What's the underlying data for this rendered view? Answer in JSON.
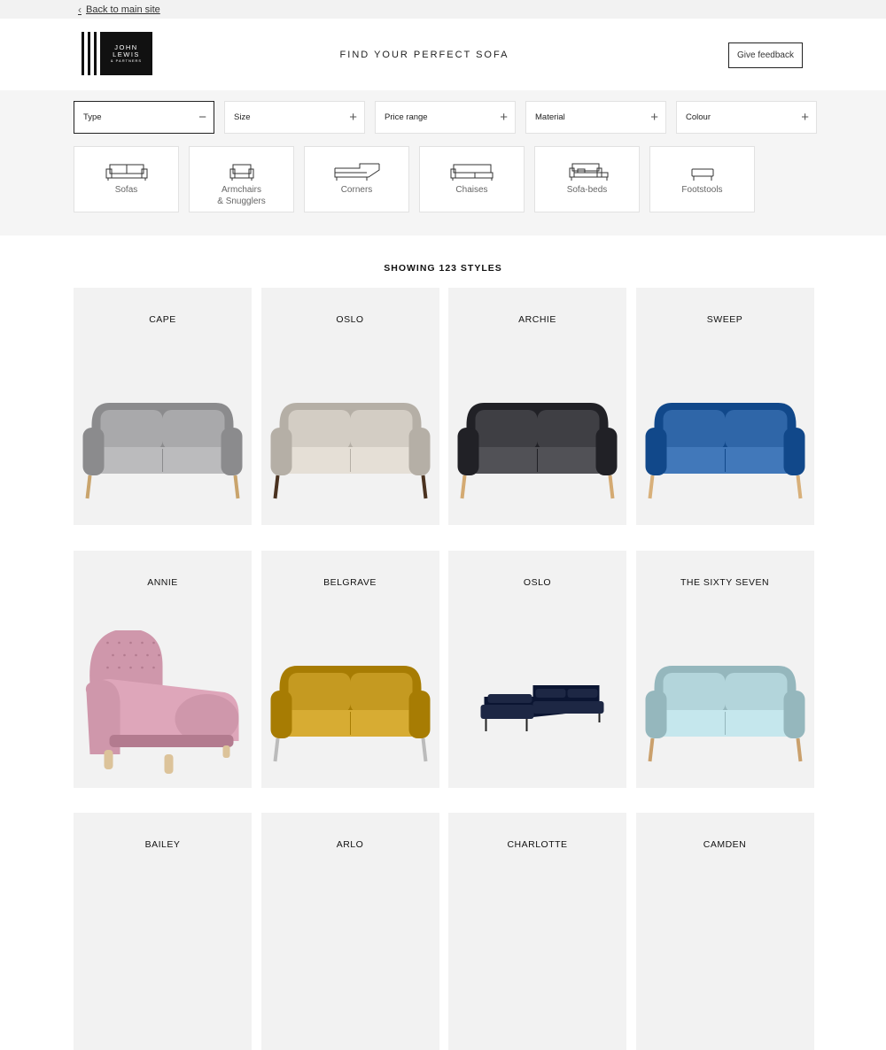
{
  "topbar": {
    "back_label": "Back to main site"
  },
  "header": {
    "logo": {
      "line1": "JOHN",
      "line2": "LEWIS",
      "line3": "& PARTNERS"
    },
    "title": "FIND YOUR PERFECT SOFA",
    "feedback_label": "Give feedback"
  },
  "filters": [
    {
      "label": "Type",
      "state": "open",
      "symbol": "−"
    },
    {
      "label": "Size",
      "state": "closed",
      "symbol": "+"
    },
    {
      "label": "Price range",
      "state": "closed",
      "symbol": "+"
    },
    {
      "label": "Material",
      "state": "closed",
      "symbol": "+"
    },
    {
      "label": "Colour",
      "state": "closed",
      "symbol": "+"
    }
  ],
  "types": [
    {
      "label": "Sofas",
      "icon": "sofa-icon"
    },
    {
      "label": "Armchairs\n& Snugglers",
      "icon": "armchair-icon"
    },
    {
      "label": "Corners",
      "icon": "corner-sofa-icon"
    },
    {
      "label": "Chaises",
      "icon": "chaise-icon"
    },
    {
      "label": "Sofa-beds",
      "icon": "sofa-bed-icon"
    },
    {
      "label": "Footstools",
      "icon": "footstool-icon"
    }
  ],
  "results": {
    "showing_label": "SHOWING 123 STYLES"
  },
  "products": [
    {
      "name": "CAPE",
      "kind": "sofa",
      "color": "#a9a9ab",
      "legs": "#c9a46c"
    },
    {
      "name": "OSLO",
      "kind": "sofa",
      "color": "#d3cdc4",
      "legs": "#4a3220"
    },
    {
      "name": "ARCHIE",
      "kind": "sofa",
      "color": "#3f3f44",
      "legs": "#d4aa72"
    },
    {
      "name": "SWEEP",
      "kind": "sofa",
      "color": "#2f66a8",
      "legs": "#d8b07a"
    },
    {
      "name": "ANNIE",
      "kind": "armchair",
      "color": "#cf97ab",
      "legs": "#dcc39a"
    },
    {
      "name": "BELGRAVE",
      "kind": "sofa",
      "color": "#c59a21",
      "legs": "#bbbbbb"
    },
    {
      "name": "OSLO",
      "kind": "corner",
      "color": "#1d2744",
      "legs": "#222222"
    },
    {
      "name": "THE SIXTY SEVEN",
      "kind": "sofa",
      "color": "#b3d5db",
      "legs": "#caa06c"
    },
    {
      "name": "BAILEY",
      "kind": "none"
    },
    {
      "name": "ARLO",
      "kind": "none"
    },
    {
      "name": "CHARLOTTE",
      "kind": "none"
    },
    {
      "name": "CAMDEN",
      "kind": "none"
    }
  ]
}
